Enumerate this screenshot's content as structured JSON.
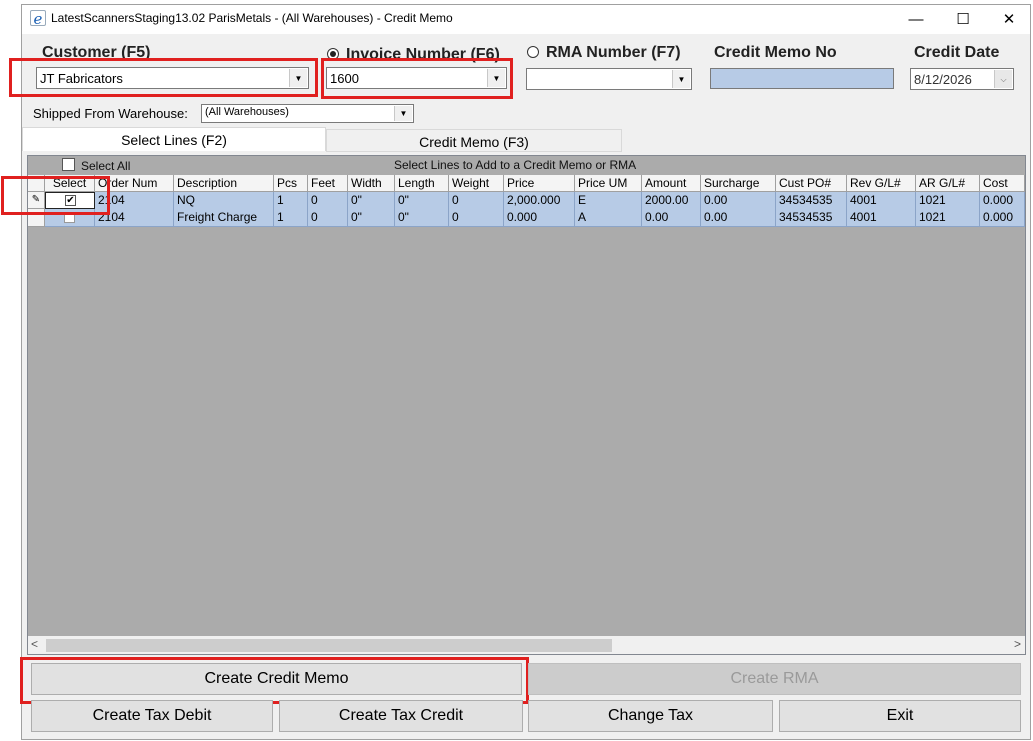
{
  "window": {
    "title": "LatestScannersStaging13.02 ParisMetals - (All Warehouses) - Credit Memo",
    "icon": "e",
    "minimize": "—",
    "maximize": "☐",
    "close": "✕"
  },
  "fields": {
    "customer_label": "Customer (F5)",
    "customer_value": "JT Fabricators",
    "invoice_label": "Invoice Number (F6)",
    "invoice_value": "1600",
    "rma_label": "RMA Number (F7)",
    "rma_value": "",
    "credit_memo_no_label": "Credit Memo No",
    "credit_memo_no_value": "",
    "credit_date_label": "Credit Date",
    "credit_date_value": "8/12/2026",
    "warehouse_label": "Shipped From Warehouse:",
    "warehouse_value": "(All Warehouses)"
  },
  "tabs": [
    {
      "label": "Select Lines (F2)",
      "active": true
    },
    {
      "label": "Credit Memo (F3)",
      "active": false
    }
  ],
  "grid": {
    "select_all_label": "Select All",
    "caption": "Select Lines to Add to a Credit Memo or RMA",
    "columns": [
      "Select",
      "Order Num",
      "Description",
      "Pcs",
      "Feet",
      "Width",
      "Length",
      "Weight",
      "Price",
      "Price UM",
      "Amount",
      "Surcharge",
      "Cust PO#",
      "Rev G/L#",
      "AR G/L#",
      "Cost"
    ],
    "rows": [
      {
        "selected": true,
        "editing": true,
        "cells": [
          "",
          "2104",
          "NQ",
          "1",
          "0",
          "0\"",
          "0\"",
          "0",
          "2,000.000",
          "E",
          "2000.00",
          "0.00",
          "34534535",
          "4001",
          "1021",
          "0.000"
        ]
      },
      {
        "selected": false,
        "editing": false,
        "cells": [
          "",
          "2104",
          "Freight Charge",
          "1",
          "0",
          "0\"",
          "0\"",
          "0",
          "0.000",
          "A",
          "0.00",
          "0.00",
          "34534535",
          "4001",
          "1021",
          "0.000"
        ]
      }
    ],
    "scroll_left": "<",
    "scroll_right": ">"
  },
  "buttons": {
    "create_credit_memo": "Create Credit Memo",
    "create_rma": "Create RMA",
    "create_tax_debit": "Create Tax Debit",
    "create_tax_credit": "Create Tax Credit",
    "change_tax": "Change Tax",
    "exit": "Exit"
  },
  "colors": {
    "highlight": "#e0201f",
    "row_selected": "#b7cbe6",
    "grid_background": "#ababab",
    "credit_memo_no_field": "#b7cbe6"
  }
}
